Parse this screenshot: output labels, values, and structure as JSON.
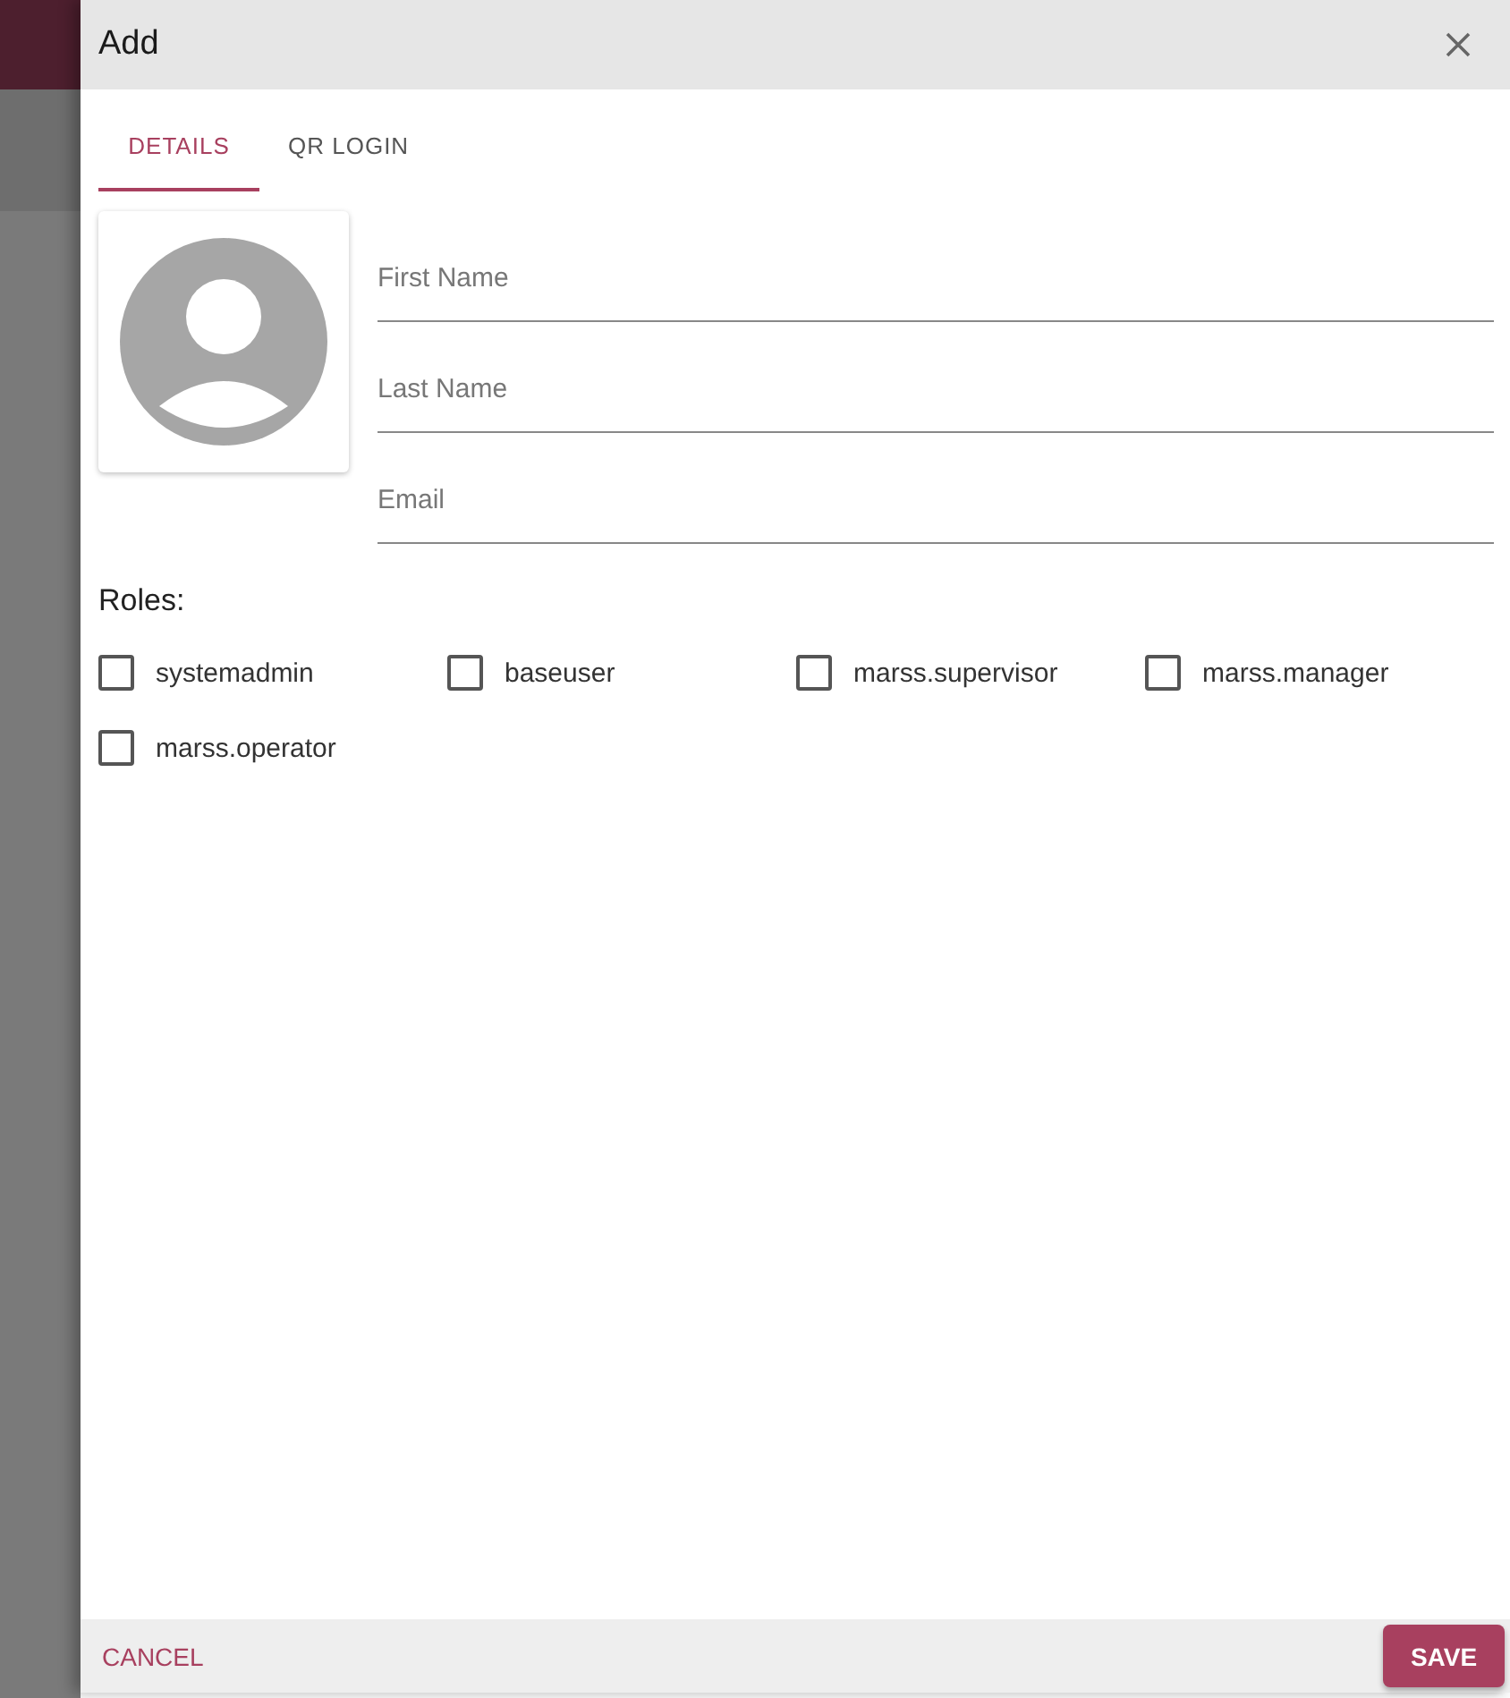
{
  "dialog": {
    "title": "Add"
  },
  "tabs": [
    {
      "label": "DETAILS",
      "selected": true
    },
    {
      "label": "QR LOGIN",
      "selected": false
    }
  ],
  "fields": [
    {
      "placeholder": "First Name"
    },
    {
      "placeholder": "Last Name"
    },
    {
      "placeholder": "Email"
    }
  ],
  "roles_heading": "Roles:",
  "roles": [
    {
      "label": "systemadmin",
      "checked": false
    },
    {
      "label": "baseuser",
      "checked": false
    },
    {
      "label": "marss.supervisor",
      "checked": false
    },
    {
      "label": "marss.manager",
      "checked": false
    },
    {
      "label": "marss.operator",
      "checked": false
    }
  ],
  "buttons": {
    "cancel": "CANCEL",
    "save": "SAVE"
  }
}
